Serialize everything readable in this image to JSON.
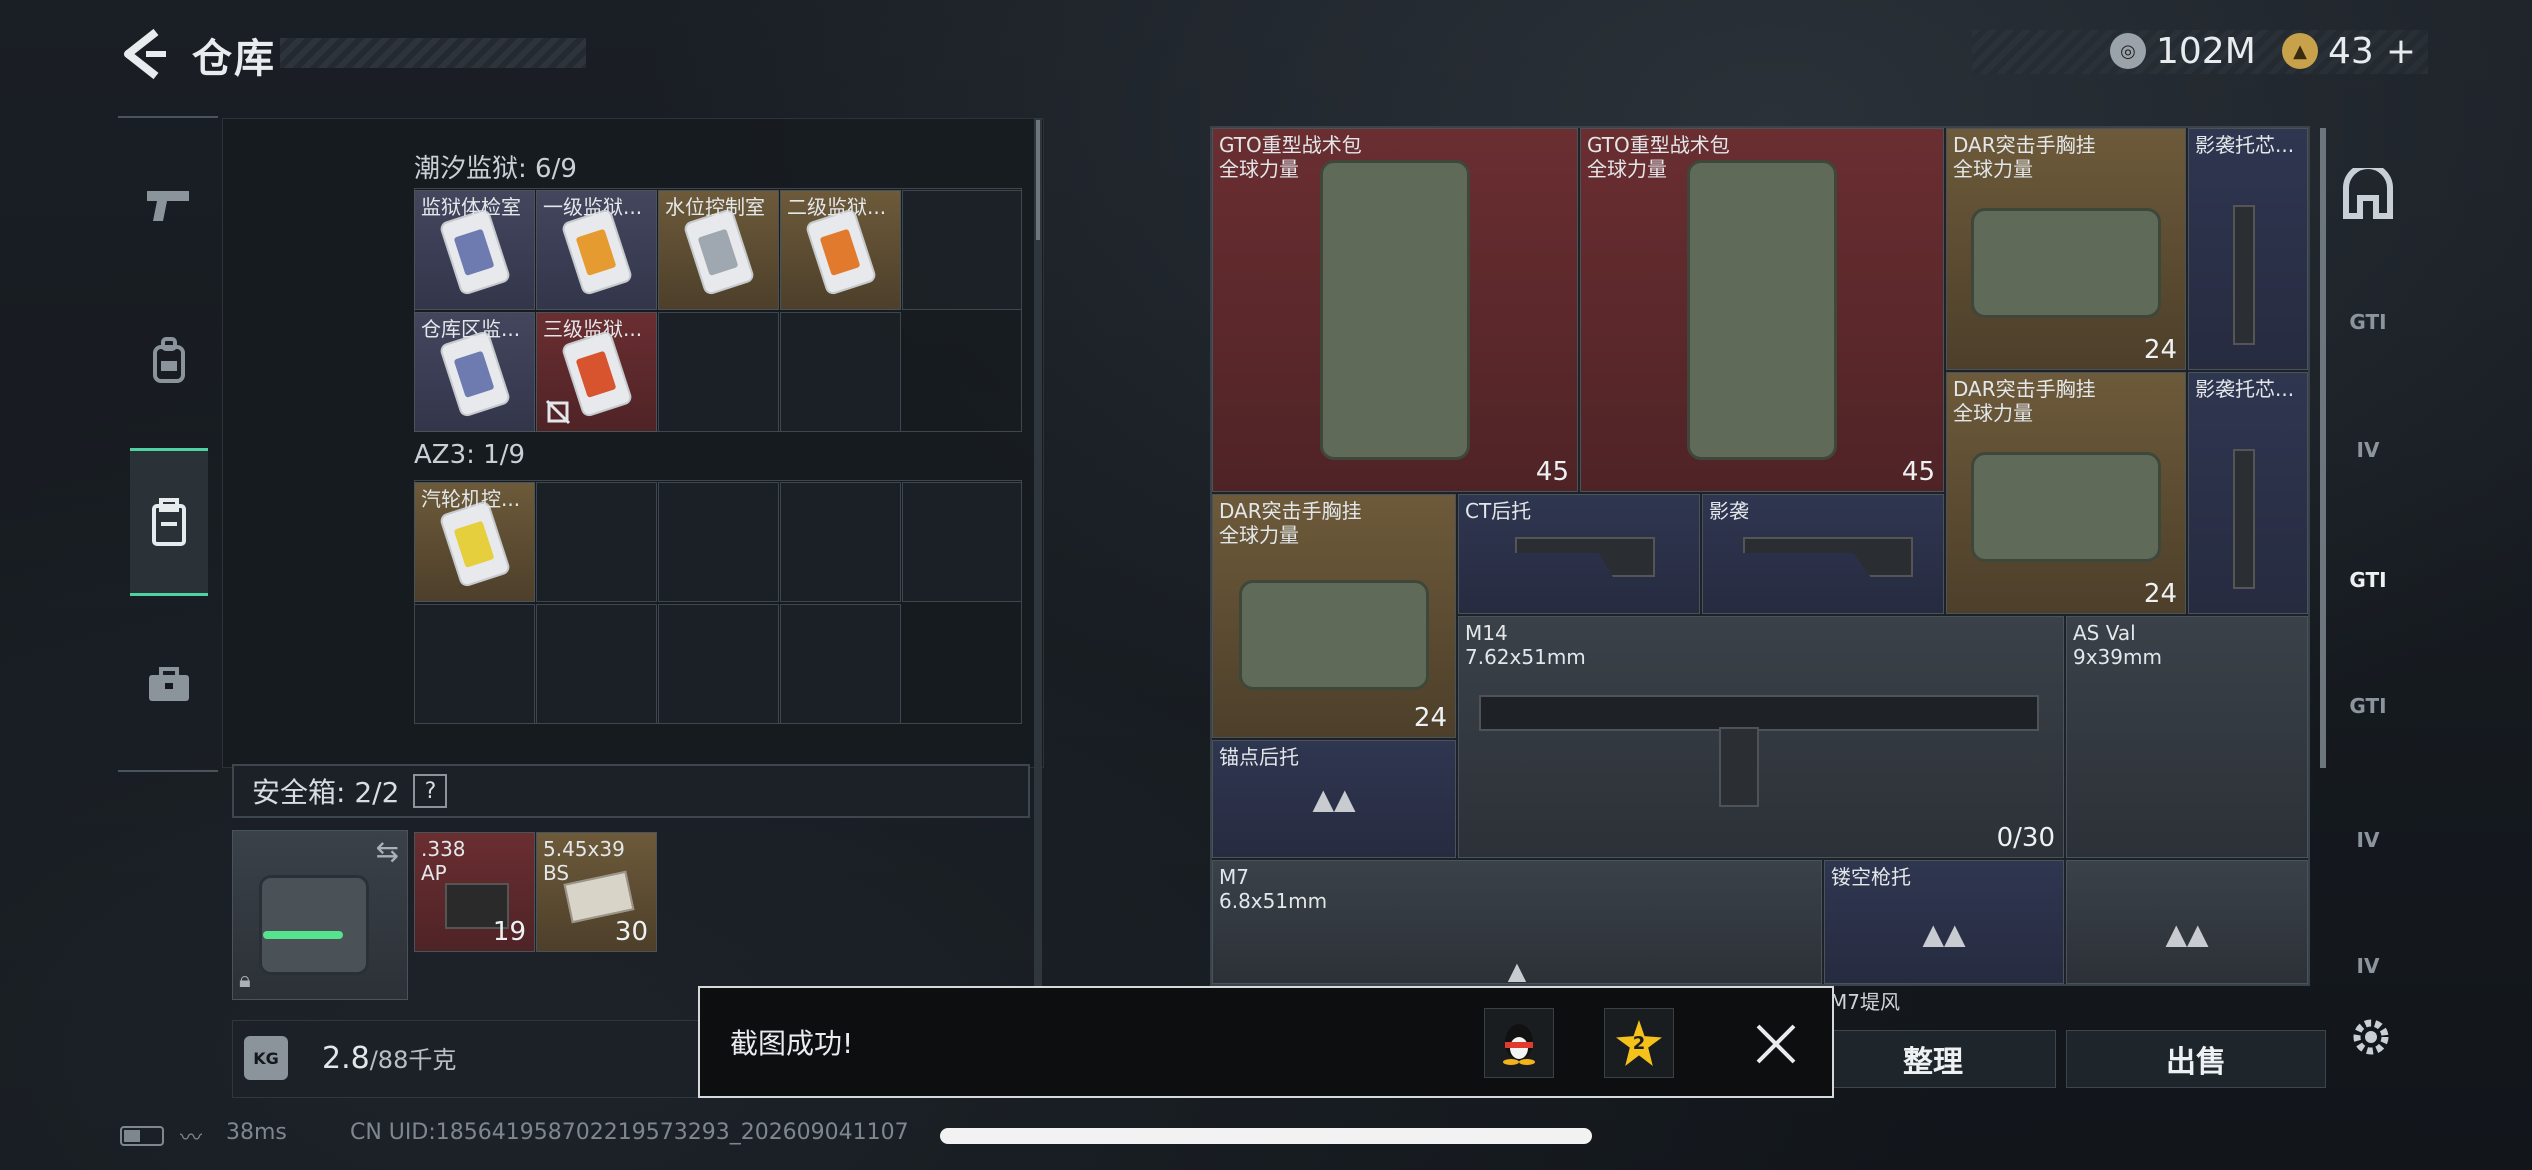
{
  "header": {
    "title": "仓库",
    "currency1": "102M",
    "currency2": "43",
    "add": "+"
  },
  "left_nav": {
    "icons": [
      "pistol-icon",
      "backpack-icon",
      "inventory-icon",
      "toolbox-icon"
    ]
  },
  "prison": {
    "label": "潮汐监狱: 6/9",
    "items": [
      "监狱体检室",
      "一级监狱...",
      "水位控制室",
      "二级监狱...",
      "仓库区监...",
      "三级监狱..."
    ]
  },
  "az3": {
    "label": "AZ3: 1/9",
    "items": [
      "汽轮机控..."
    ]
  },
  "safe_box": {
    "label": "安全箱: 2/2",
    "help": "?",
    "items": [
      {
        "name1": ".338",
        "name2": "AP",
        "count": "19"
      },
      {
        "name1": "5.45x39",
        "name2": "BS",
        "count": "30"
      }
    ]
  },
  "weight": {
    "value": "2.8",
    "max": "/88千克",
    "icon_text": "KG"
  },
  "stash": {
    "items": [
      {
        "n1": "GTO重型战术包",
        "n2": "全球力量",
        "count": "45"
      },
      {
        "n1": "GTO重型战术包",
        "n2": "全球力量",
        "count": "45"
      },
      {
        "n1": "DAR突击手胸挂",
        "n2": "全球力量",
        "count": "24"
      },
      {
        "n1": "影袭托芯..."
      },
      {
        "n1": "DAR突击手胸挂",
        "n2": "全球力量",
        "count": "24"
      },
      {
        "n1": "影袭托芯..."
      },
      {
        "n1": "DAR突击手胸挂",
        "n2": "全球力量",
        "count": "24"
      },
      {
        "n1": "CT后托"
      },
      {
        "n1": "影袭"
      },
      {
        "n1": "M14",
        "n2": "7.62x51mm",
        "count": "0/30"
      },
      {
        "n1": "AS Val",
        "n2": "9x39mm"
      },
      {
        "n1": "锚点后托"
      },
      {
        "n1": "M7",
        "n2": "6.8x51mm"
      },
      {
        "n1": "镂空枪托"
      },
      {
        "n1": "M7堤风"
      }
    ]
  },
  "right_nav": {
    "labels": [
      "GTI",
      "IV",
      "GTI",
      "GTI",
      "IV",
      "IV"
    ]
  },
  "buttons": {
    "sort": "整理",
    "sell": "出售"
  },
  "toast": {
    "text": "截图成功!",
    "badge": "2"
  },
  "status_bar": {
    "ping": "38ms",
    "uid": "CN UID:18564195870221957329​3_202609041107"
  }
}
